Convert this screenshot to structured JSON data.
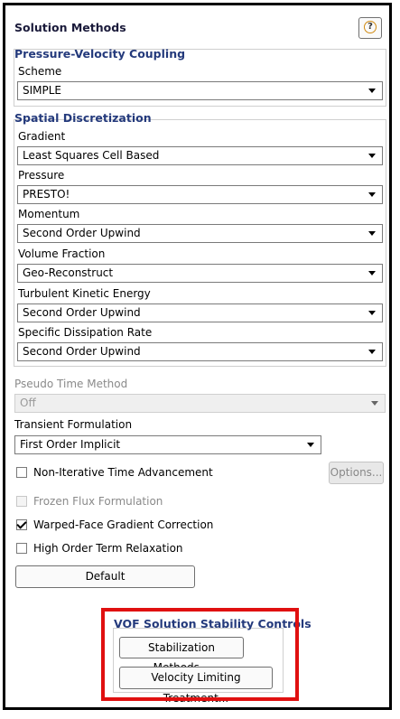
{
  "panel": {
    "title": "Solution Methods",
    "help_label": "?"
  },
  "pv_coupling": {
    "header": "Pressure-Velocity Coupling",
    "scheme_label": "Scheme",
    "scheme_value": "SIMPLE"
  },
  "spatial": {
    "header": "Spatial Discretization",
    "gradient_label": "Gradient",
    "gradient_value": "Least Squares Cell Based",
    "pressure_label": "Pressure",
    "pressure_value": "PRESTO!",
    "momentum_label": "Momentum",
    "momentum_value": "Second Order Upwind",
    "volume_fraction_label": "Volume Fraction",
    "volume_fraction_value": "Geo-Reconstruct",
    "tke_label": "Turbulent Kinetic Energy",
    "tke_value": "Second Order Upwind",
    "sdr_label": "Specific Dissipation Rate",
    "sdr_value": "Second Order Upwind"
  },
  "pseudo_time": {
    "label": "Pseudo Time Method",
    "value": "Off"
  },
  "transient": {
    "label": "Transient Formulation",
    "value": "First Order Implicit"
  },
  "options": {
    "non_iterative": {
      "label": "Non-Iterative Time Advancement",
      "checked": false
    },
    "options_button": "Options...",
    "frozen_flux": {
      "label": "Frozen Flux Formulation",
      "checked": false
    },
    "warped_face": {
      "label": "Warped-Face Gradient Correction",
      "checked": true
    },
    "high_order": {
      "label": "High Order Term Relaxation",
      "checked": false
    }
  },
  "default_button": "Default",
  "vof": {
    "header": "VOF Solution Stability Controls",
    "stabilization_button": "Stabilization Methods...",
    "velocity_limiting_button": "Velocity Limiting Treatment..."
  },
  "colors": {
    "section_header": "#243a7c",
    "highlight": "#e01010",
    "help_ring": "#d08a12"
  }
}
